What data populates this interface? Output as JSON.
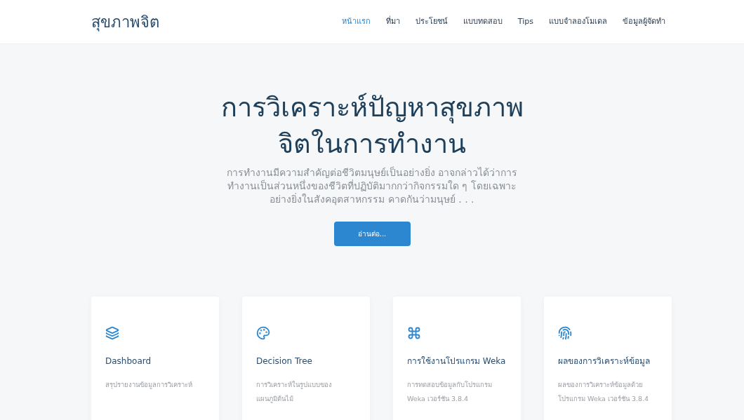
{
  "navbar": {
    "brand": "สุขภาพจิต",
    "links": [
      {
        "label": "หน้าแรก",
        "selected": true
      },
      {
        "label": "ที่มา",
        "selected": false
      },
      {
        "label": "ประโยชน์",
        "selected": false
      },
      {
        "label": "แบบทดสอบ",
        "selected": false
      },
      {
        "label": "Tips",
        "selected": false
      },
      {
        "label": "แบบจำลองโมเดล",
        "selected": false
      },
      {
        "label": "ข้อมูลผู้จัดทำ",
        "selected": false
      }
    ]
  },
  "hero": {
    "title_lines": [
      "การวิเคราะห์ปัญหาสุขภาพ",
      "จิตในการทำงาน"
    ],
    "paragraph_lines": [
      "การทำงานมีความสำคัญต่อชีวิตมนุษย์เป็นอย่างยิ่ง อาจกล่าวได้ว่าการ",
      "ทำงานเป็นส่วนหนึ่งของชีวิตที่ปฏิบัติมากกว่ากิจกรรมใด ๆ โดยเฉพาะ",
      "อย่างยิ่งในสังคอุตสาหกรรม คาดกันว่ามนุษย์ . . ."
    ],
    "button": "อ่านต่อ..."
  },
  "cards": [
    {
      "title": "Dashboard",
      "description_lines": [
        "สรุปรายงานข้อมูลการวิเคราะห์"
      ]
    },
    {
      "title": "Decision Tree",
      "description_lines": [
        "การวิเคราะห์ในรูปแบบของ",
        "แผนภูมิต้นไม้"
      ]
    },
    {
      "title": "การใช้งานโปรแกรม Weka",
      "description_lines": [
        "การทดสอบข้อมูลกับโปรแกรม",
        "Weka เวอร์ชัน 3.8.4"
      ]
    },
    {
      "title": "ผลของการวิเคราะห์ข้อมูล",
      "description_lines": [
        "ผลของการวิเคราะห์ข้อมูลด้วย",
        "โปรแกรม Weka เวอร์ชัน 3.8.4"
      ]
    }
  ]
}
